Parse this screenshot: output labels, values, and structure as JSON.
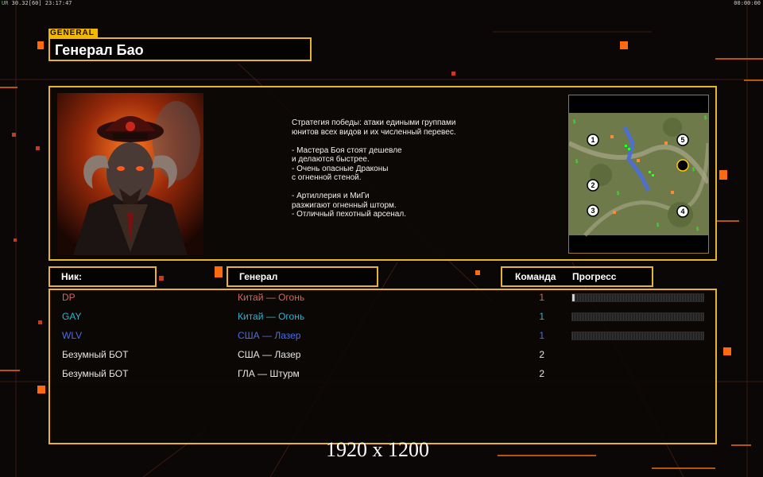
{
  "topbar": {
    "left_green": "UR",
    "left_text": "30.32[60] 23:17:47",
    "right_text": "00:00:00"
  },
  "general_tag": "GENERAL",
  "title": "Генерал Бао",
  "description": "Стратегия победы: атаки едиными группами\nюнитов всех видов и их численный перевес.\n\n- Мастера Боя стоят дешевле\nи делаются быстрее.\n- Очень опасные Драконы\nс огненной стеной.\n\n- Артиллерия и МиГи\nразжигают огненный шторм.\n- Отличный пехотный арсенал.",
  "minimap": {
    "start_positions": [
      "1",
      "2",
      "3",
      "4",
      "5"
    ],
    "marker_label": "$"
  },
  "headers": {
    "nick": "Ник:",
    "general": "Генерал",
    "team": "Команда",
    "progress": "Прогресс"
  },
  "players": [
    {
      "nick": "DP",
      "general": "Китай — Огонь",
      "team": "1",
      "color": "#d06a5e",
      "progress": 0.02,
      "show_bar": true
    },
    {
      "nick": "GAY",
      "general": "Китай — Огонь",
      "team": "1",
      "color": "#2fb3d1",
      "progress": 0.0,
      "show_bar": true
    },
    {
      "nick": "WLV",
      "general": "США — Лазер",
      "team": "1",
      "color": "#4d6de0",
      "progress": 0.0,
      "show_bar": true
    },
    {
      "nick": "Безумный БОТ",
      "general": "США — Лазер",
      "team": "2",
      "color": "#e6e6e6",
      "progress": 0,
      "show_bar": false
    },
    {
      "nick": "Безумный БОТ",
      "general": "ГЛА — Штурм",
      "team": "2",
      "color": "#e6e6e6",
      "progress": 0,
      "show_bar": false
    }
  ],
  "resolution_label": "1920 x 1200",
  "colors": {
    "accent": "#e8b52a",
    "orange": "#ff7a1a",
    "background": "#0b0706"
  }
}
